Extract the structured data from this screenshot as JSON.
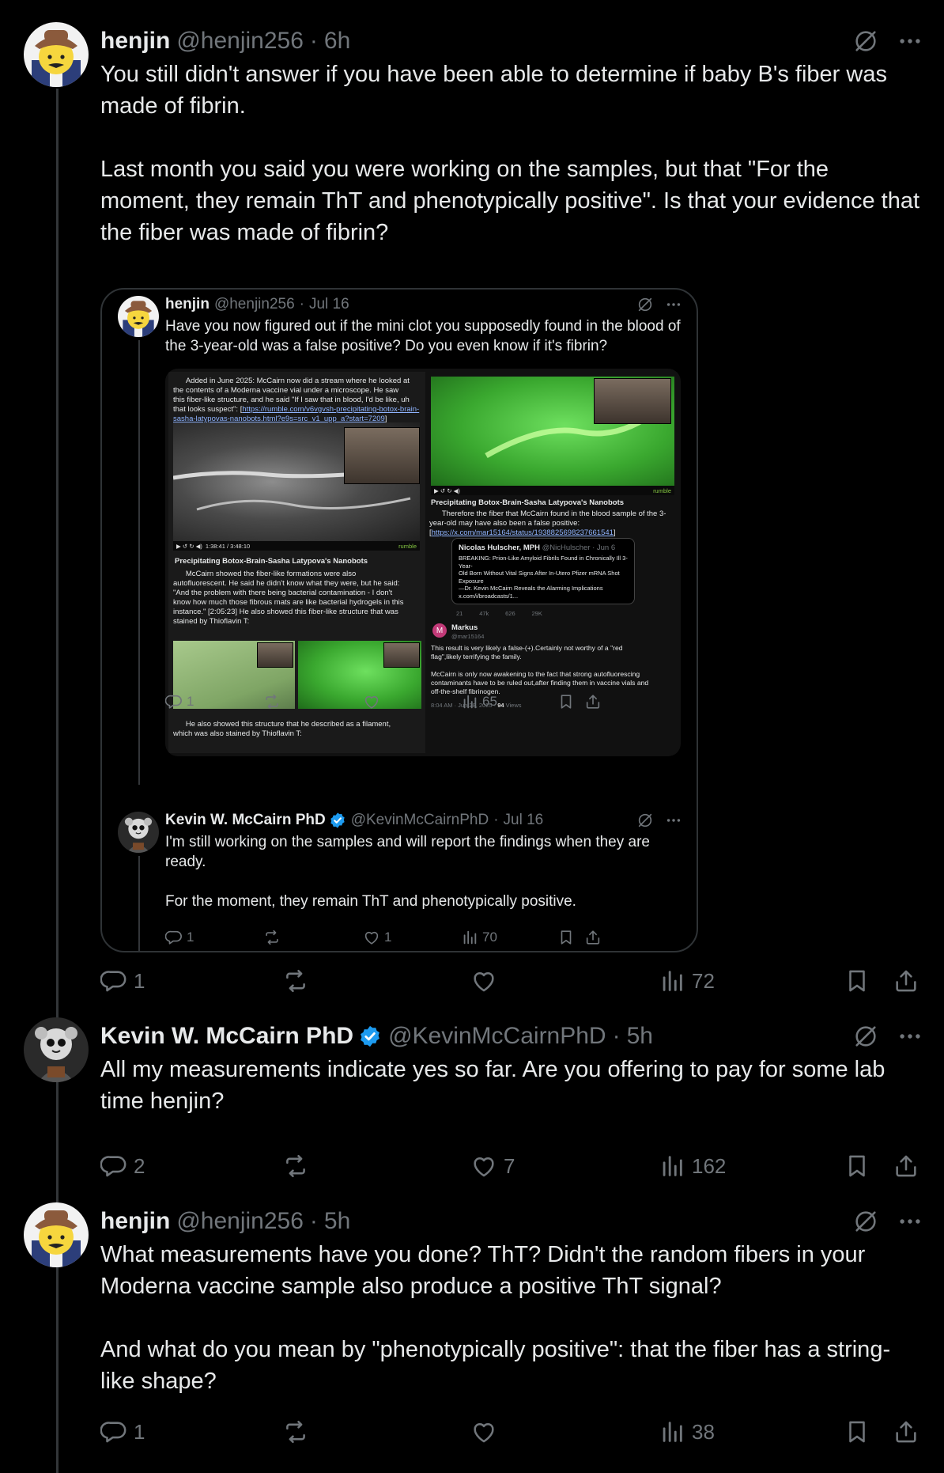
{
  "posts": [
    {
      "name": "henjin",
      "handle": "@henjin256",
      "time": "6h",
      "text": "You still didn't answer if you have been able to determine if baby B's fiber was made of fibrin.\n\nLast month you said you were working on the samples, but that \"For the moment, they remain ThT and phenotypically positive\". Is that your evidence that the fiber was made of fibrin?",
      "replies": "1",
      "reposts": "",
      "likes": "",
      "views": "72"
    },
    {
      "name": "Kevin W. McCairn PhD",
      "handle": "@KevinMcCairnPhD",
      "time": "5h",
      "verified": true,
      "text": "All my measurements indicate yes so far. Are you offering to pay for some lab time henjin?",
      "replies": "2",
      "reposts": "",
      "likes": "7",
      "views": "162"
    },
    {
      "name": "henjin",
      "handle": "@henjin256",
      "time": "5h",
      "text": "What measurements have you done? ThT? Didn't the random fibers in your Moderna vaccine sample also produce a positive ThT signal?\n\nAnd what do you mean by \"phenotypically positive\": that the fiber has a string-like shape?",
      "replies": "1",
      "reposts": "",
      "likes": "",
      "views": "38"
    }
  ],
  "quote": {
    "first": {
      "name": "henjin",
      "handle": "@henjin256",
      "time": "Jul 16",
      "text": "Have you now figured out if the mini clot you supposedly found in the blood of the 3-year-old was a false positive? Do you even know if it's fibrin?",
      "replies": "1",
      "reposts": "",
      "likes": "",
      "views": "65"
    },
    "second": {
      "name": "Kevin W. McCairn PhD",
      "handle": "@KevinMcCairnPhD",
      "time": "Jul 16",
      "text": "I'm still working on the samples and will report the findings when they are ready.\n\nFor the moment, they remain ThT and phenotypically positive.",
      "replies": "1",
      "reposts": "",
      "likes": "1",
      "views": "70"
    },
    "media": {
      "left_intro": "      Added in June 2025: McCairn now did a stream where he looked at\nthe contents of a Moderna vaccine vial under a microscope. He saw\nthis fiber-like structure, and he said \"If I saw that in blood, I'd be like, uh\nthat looks suspect\": [",
      "left_link": "https://rumble.com/v6vgvsh-precipitating-botox-brain-sasha-latypovas-nanobots.html?e9s=src_v1_upp_a?start=7209",
      "left_title": "Precipitating Botox-Brain-Sasha Latypova's Nanobots",
      "left_para": "      McCairn showed the fiber-like formations were also\nautofluorescent. He said he didn't know what they were, but he said:\n\"And the problem with there being bacterial contamination - I don't\nknow how much those fibrous mats are like bacterial hydrogels in this\ninstance.\" [2:05:23] He also showed this fiber-like structure that was\nstained by Thioflavin T:",
      "left_bottom": "      He also showed this structure that he described as a filament,\nwhich was also stained by Thioflavin T:",
      "player_time": "1:38:41 / 3:48:10",
      "rumble": "rumble",
      "right_title": "Precipitating Botox-Brain-Sasha Latypova's Nanobots",
      "right_para": "      Therefore the fiber that McCairn found in the blood sample of the 3-\nyear-old may have also been a false positive:",
      "right_link": "https://x.com/mar15164/status/1938825698237661541",
      "card_name": "Nicolas Hulscher, MPH",
      "card_handle": "@NicHulscher · Jun 6",
      "card_text": "BREAKING: Prion-Like Amyloid Fibrils Found in Chronically Ill 3-Year-\nOld Born Without Vital Signs After In-Utero Pfizer mRNA Shot Exposure\n—Dr. Kevin McCairn Reveals the Alarming Implications\nx.com/i/broadcasts/1...",
      "card_stats": [
        "21",
        "47k",
        "626",
        "29K"
      ],
      "markus_name": "Markus",
      "markus_handle": "@mar15164",
      "markus_text": "This result is very likely a false-(+).Certainly not worthy of a \"red\nflag\",likely terrifying the family.\n\nMcCairn is only now awakening to the fact that strong autofluorescing\ncontaminants have to be ruled out,after finding them in vaccine vials and\noff-the-shelf fibrinogen.",
      "markus_meta": "8:04 AM · Jun 28, 2025 · ",
      "markus_views": "94",
      "markus_views_label": " Views"
    }
  },
  "colors": {
    "background": "#000000",
    "text": "#e7e9ea",
    "muted": "#71767b",
    "border": "#2f3336",
    "verified": "#1d9bf0",
    "link": "#8fb4ff"
  },
  "icons": [
    "reply-icon",
    "repost-icon",
    "like-icon",
    "views-icon",
    "bookmark-icon",
    "share-icon",
    "grok-icon",
    "more-icon",
    "verified-icon"
  ]
}
